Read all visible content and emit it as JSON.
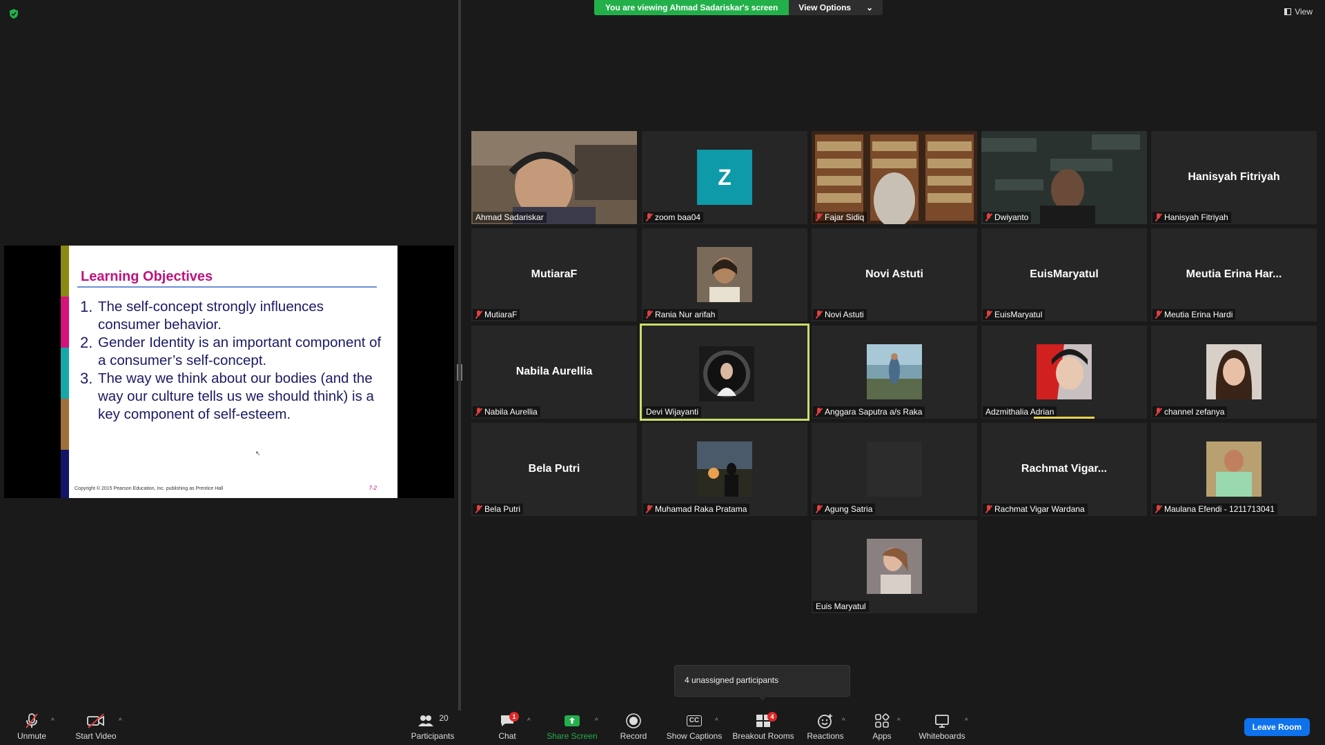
{
  "banner": {
    "viewing_text": "You are viewing Ahmad Sadariskar's screen",
    "view_options": "View Options",
    "view": "View"
  },
  "slide": {
    "title": "Learning Objectives",
    "items": [
      {
        "num": "1.",
        "text": "The self-concept strongly influences consumer behavior."
      },
      {
        "num": "2.",
        "text": "Gender Identity is an important component of a consumer’s self-concept."
      },
      {
        "num": "3.",
        "text": "The way we think about our bodies (and the way our culture tells us we should think) is a key component of self-esteem."
      }
    ],
    "footer": "Copyright © 2015 Pearson Education, Inc. publishing as Prentice Hall",
    "page": "7-2",
    "bar_colors": [
      "#8a8a10",
      "#d4147a",
      "#16a8a8",
      "#a0703a",
      "#141466"
    ]
  },
  "participants": [
    {
      "label": "Ahmad Sadariskar",
      "kind": "video",
      "muted": false
    },
    {
      "label": "zoom baa04",
      "kind": "avatar",
      "initial": "Z",
      "muted": true
    },
    {
      "label": "Fajar Sidiq",
      "kind": "video",
      "muted": true
    },
    {
      "label": "Dwiyanto",
      "kind": "video",
      "muted": true
    },
    {
      "label": "Hanisyah Fitriyah",
      "kind": "name",
      "big": "Hanisyah Fitriyah",
      "muted": true
    },
    {
      "label": "MutiaraF",
      "kind": "name",
      "big": "MutiaraF",
      "muted": true
    },
    {
      "label": "Rania Nur arifah",
      "kind": "photo",
      "muted": true
    },
    {
      "label": "Novi Astuti",
      "kind": "name",
      "big": "Novi Astuti",
      "muted": true
    },
    {
      "label": "EuisMaryatul",
      "kind": "name",
      "big": "EuisMaryatul",
      "muted": true
    },
    {
      "label": "Meutia Erina Hardi",
      "kind": "name",
      "big": "Meutia Erina Har...",
      "muted": true
    },
    {
      "label": "Nabila Aurellia",
      "kind": "name",
      "big": "Nabila Aurellia",
      "muted": true
    },
    {
      "label": "Devi Wijayanti",
      "kind": "photo",
      "muted": false,
      "active": true
    },
    {
      "label": "Anggara Saputra a/s Raka",
      "kind": "photo",
      "muted": true
    },
    {
      "label": "Adzmithalia Adrian",
      "kind": "photo",
      "muted": false,
      "talking": true
    },
    {
      "label": "channel zefanya",
      "kind": "photo",
      "muted": true
    },
    {
      "label": "Bela Putri",
      "kind": "name",
      "big": "Bela Putri",
      "muted": true
    },
    {
      "label": "Muhamad Raka Pratama",
      "kind": "photo",
      "muted": true
    },
    {
      "label": "Agung Satria",
      "kind": "photo",
      "muted": true
    },
    {
      "label": "Rachmat Vigar Wardana",
      "kind": "name",
      "big": "Rachmat Vigar...",
      "muted": true
    },
    {
      "label": "Maulana Efendi - 1211713041",
      "kind": "photo",
      "muted": true
    },
    {
      "label": "Euis Maryatul",
      "kind": "photo",
      "muted": false
    }
  ],
  "tooltip": "4 unassigned participants",
  "toolbar": {
    "unmute": "Unmute",
    "start_video": "Start Video",
    "participants": "Participants",
    "participants_count": "20",
    "chat": "Chat",
    "chat_badge": "1",
    "share_screen": "Share Screen",
    "record": "Record",
    "show_captions": "Show Captions",
    "captions_icon": "CC",
    "breakout_rooms": "Breakout Rooms",
    "breakout_badge": "4",
    "reactions": "Reactions",
    "apps": "Apps",
    "whiteboards": "Whiteboards",
    "leave_room": "Leave Room"
  },
  "colors": {
    "share_green": "#23b04b",
    "leave_blue": "#0e72ed",
    "active_border": "#c8e06a",
    "mute_red": "#e04040"
  }
}
